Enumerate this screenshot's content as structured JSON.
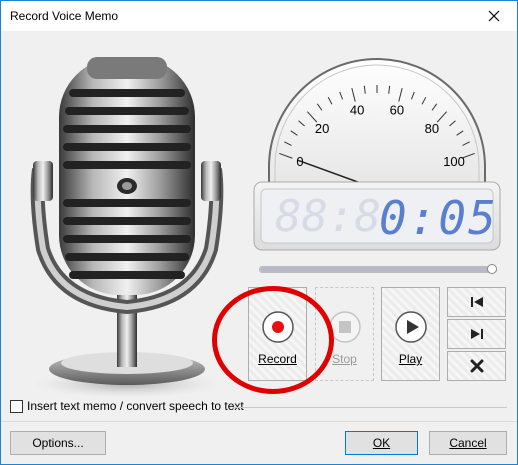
{
  "window": {
    "title": "Record Voice Memo"
  },
  "gauge": {
    "labels": [
      "0",
      "20",
      "40",
      "60",
      "80",
      "100"
    ],
    "value": 0
  },
  "display": {
    "time": "0:05"
  },
  "progress": {
    "level": 1.0
  },
  "buttons": {
    "record_label": "Record",
    "stop_label": "Stop",
    "play_label": "Play",
    "options_label": "Options...",
    "ok_label": "OK",
    "cancel_label": "Cancel"
  },
  "checkbox": {
    "label": "Insert text memo / convert speech to text",
    "checked": false
  },
  "colors": {
    "record_dot": "#e81010",
    "highlight_circle": "#e00000",
    "lcd_digits": "#5a7fd0",
    "title_border": "#1883d7"
  }
}
